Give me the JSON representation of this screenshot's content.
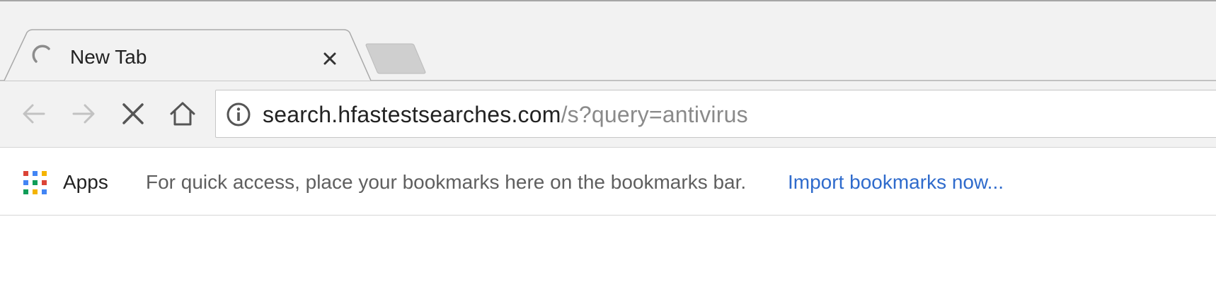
{
  "tab": {
    "title": "New Tab",
    "loading": true
  },
  "toolbar": {
    "url_host": "search.hfastestsearches.com",
    "url_path": "/s?query=antivirus"
  },
  "bookmarks_bar": {
    "apps_label": "Apps",
    "hint": "For quick access, place your bookmarks here on the bookmarks bar.",
    "import_link": "Import bookmarks now..."
  },
  "colors": {
    "chrome_bg": "#f2f2f2",
    "link_blue": "#2f6bcc",
    "url_path_gray": "#8a8a8a",
    "apps_grid": [
      "#db4437",
      "#4285f4",
      "#0f9d58",
      "#f4b400"
    ]
  },
  "icons": {
    "tab": "loading-spinner-icon",
    "close": "close-icon",
    "back": "back-arrow-icon",
    "forward": "forward-arrow-icon",
    "stop": "stop-icon",
    "home": "home-icon",
    "site_info": "info-icon",
    "apps": "apps-grid-icon"
  }
}
